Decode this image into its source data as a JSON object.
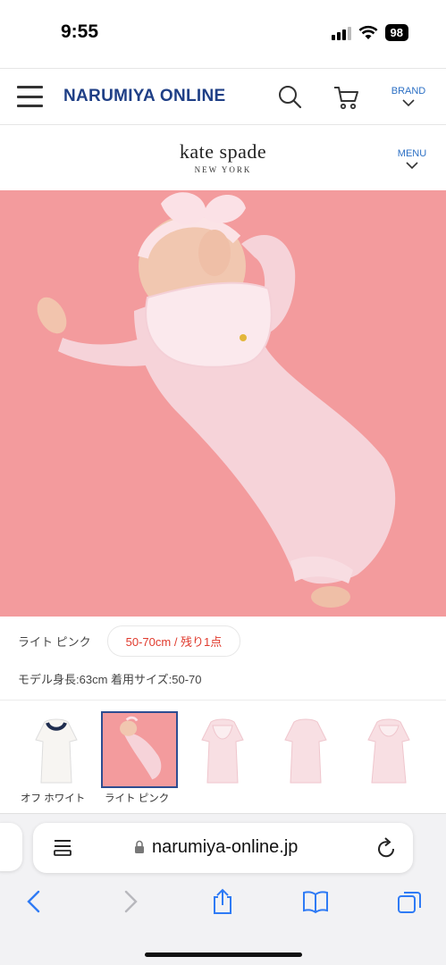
{
  "status_bar": {
    "time": "9:55",
    "battery": "98"
  },
  "header": {
    "logo": "NARUMIYA ONLINE",
    "brand_label": "BRAND"
  },
  "brand_bar": {
    "name": "kate spade",
    "sub": "NEW YORK",
    "menu_label": "MENU"
  },
  "product": {
    "color_label": "ライト ピンク",
    "size_label": "50-70cm / 残り1点",
    "model_info": "モデル身長:63cm 着用サイズ:50-70"
  },
  "thumbnails": [
    {
      "label": "オフ ホワイト",
      "selected": false
    },
    {
      "label": "ライト ピンク",
      "selected": true
    },
    {
      "label": "",
      "selected": false
    },
    {
      "label": "",
      "selected": false
    },
    {
      "label": "",
      "selected": false
    }
  ],
  "browser": {
    "url": "narumiya-online.jp"
  },
  "colors": {
    "logo_blue": "#1f3f86",
    "link_blue": "#2b6fc4",
    "stock_red": "#e03b2e",
    "photo_pink": "#f39b9d"
  }
}
